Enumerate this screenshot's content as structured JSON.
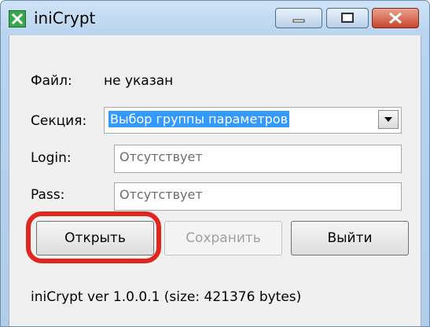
{
  "window": {
    "title": "iniCrypt",
    "app_icon": "inicrypt-app-icon",
    "controls": [
      "minimize-icon",
      "maximize-icon",
      "close-icon"
    ]
  },
  "form": {
    "file_label": "Файл:",
    "file_value": "не указан",
    "section_label": "Секция:",
    "section_value": "Выбор группы параметров",
    "login_label": "Login:",
    "login_value": "Отсутствует",
    "pass_label": "Pass:",
    "pass_value": "Отсутствует"
  },
  "buttons": {
    "open": "Открыть",
    "save": "Сохранить",
    "exit": "Выйти"
  },
  "status": {
    "text": "iniCrypt ver 1.0.0.1 (size: 421376 bytes)"
  },
  "colors": {
    "selection": "#3399ff",
    "highlight_annotation": "#e0261f",
    "close_button": "#c8452b"
  }
}
